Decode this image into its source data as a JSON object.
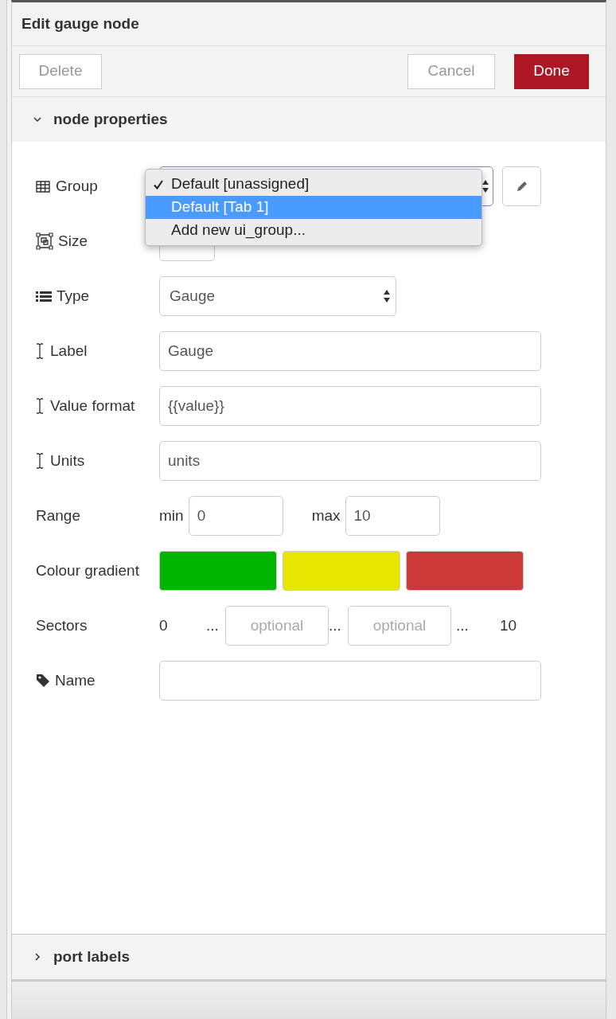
{
  "window": {
    "title": "Edit gauge node"
  },
  "toolbar": {
    "buttons": [
      {
        "label": "Delete",
        "kind": "plain"
      },
      {
        "label": "Cancel",
        "kind": "plain"
      },
      {
        "label": "Done",
        "kind": "primary"
      }
    ]
  },
  "sections": [
    {
      "title": "node properties",
      "expanded": true
    },
    {
      "title": "port labels",
      "expanded": false
    }
  ],
  "group": {
    "label": "Group",
    "options": [
      {
        "label": "Default [unassigned]",
        "checked": true,
        "selected": false
      },
      {
        "label": "Default [Tab 1]",
        "checked": false,
        "selected": true
      },
      {
        "label": "Add new ui_group...",
        "checked": false,
        "selected": false
      }
    ]
  },
  "size": {
    "label": "Size"
  },
  "type": {
    "label": "Type",
    "value": "Gauge"
  },
  "fields": [
    {
      "label": "Label",
      "value": "Gauge"
    },
    {
      "label": "Value format",
      "value": "{{value}}"
    },
    {
      "label": "Units",
      "value": "units"
    }
  ],
  "range": {
    "label": "Range",
    "min_label": "min",
    "min": "0",
    "max_label": "max",
    "max": "10"
  },
  "colour_gradient": {
    "label": "Colour gradient",
    "swatches": [
      {
        "color": "#00b500"
      },
      {
        "color": "#e6e600"
      },
      {
        "color": "#ca3838"
      }
    ]
  },
  "sectors": {
    "label": "Sectors",
    "start": "0",
    "end": "10",
    "separators": [
      "...",
      "...",
      "..."
    ],
    "inputs": [
      {
        "placeholder": "optional"
      },
      {
        "placeholder": "optional"
      }
    ]
  },
  "name": {
    "label": "Name"
  }
}
